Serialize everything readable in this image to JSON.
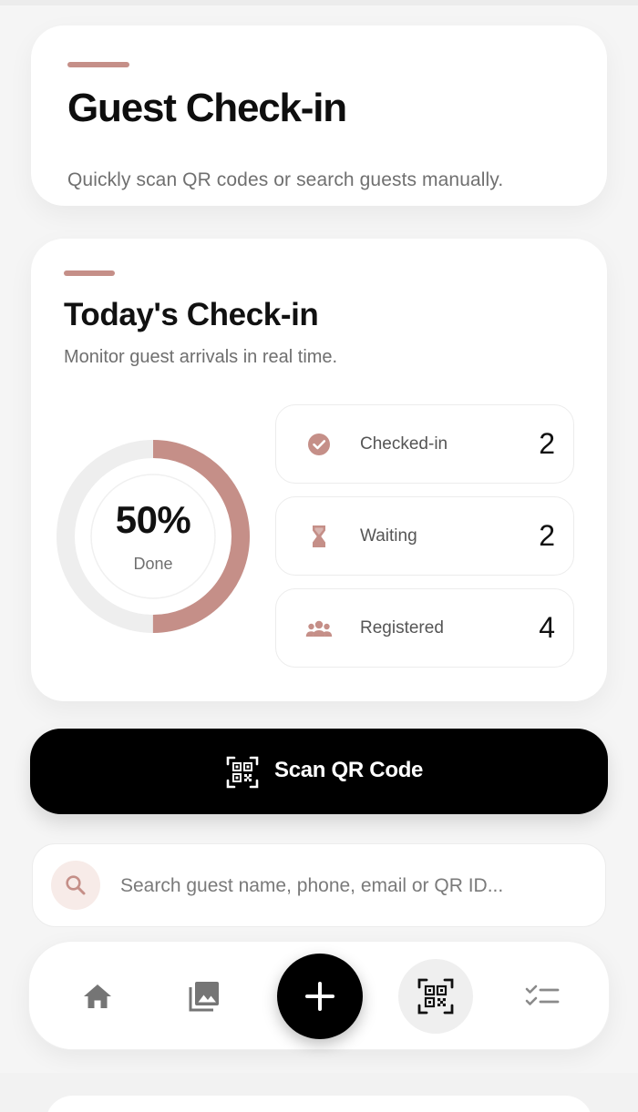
{
  "header": {
    "title": "Guest Check-in",
    "subtitle": "Quickly scan QR codes or search guests manually."
  },
  "today": {
    "title": "Today's Check-in",
    "subtitle": "Monitor guest arrivals in real time.",
    "progress": {
      "percent_label": "50%",
      "done_label": "Done",
      "fraction": 0.5
    },
    "stats": [
      {
        "icon": "check-circle-icon",
        "label": "Checked-in",
        "value": "2"
      },
      {
        "icon": "hourglass-icon",
        "label": "Waiting",
        "value": "2"
      },
      {
        "icon": "group-icon",
        "label": "Registered",
        "value": "4"
      }
    ]
  },
  "scan_button": {
    "label": "Scan QR Code",
    "icon": "qr-scan-icon"
  },
  "search": {
    "placeholder": "Search guest name, phone, email or QR ID...",
    "value": ""
  },
  "nav": {
    "items": [
      {
        "icon": "home-icon"
      },
      {
        "icon": "gallery-icon"
      },
      {
        "icon": "add-icon"
      },
      {
        "icon": "qr-scan-icon",
        "active": true
      },
      {
        "icon": "checklist-icon"
      }
    ]
  },
  "colors": {
    "accent": "#c58f88",
    "accent_light": "#f7ebe8",
    "ring_track": "#eeeeee",
    "primary_button": "#000000",
    "background": "#f5f5f5"
  }
}
